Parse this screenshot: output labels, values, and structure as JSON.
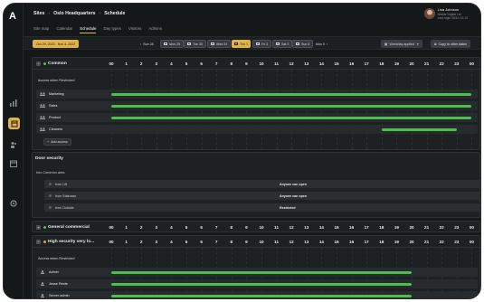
{
  "app": {
    "logo": "A"
  },
  "breadcrumb": {
    "sites": "Sites",
    "location": "Oslo Headquarters",
    "page": "Schedule"
  },
  "nav_tabs": [
    "Site map",
    "Calendar",
    "Schedule",
    "Day types",
    "Visitors",
    "Admins"
  ],
  "active_tab": "Schedule",
  "user": {
    "name": "Lisa Johnson",
    "line2": "Nektar Digital Ltd",
    "line3": "Last login 06/10 12:14"
  },
  "toolbar": {
    "date_range": "Oct 29, 2022 - Nov 4, 2022",
    "days": [
      "Sun 28",
      "Mon 29",
      "Tue 30",
      "Wed 31",
      "Thu 1",
      "Fri 2",
      "Sat 3",
      "Sun 4",
      "Mon 5"
    ],
    "selected_day": "Thu 1",
    "weekday_label": "Weekday applied",
    "copy_label": "Copy to other dates"
  },
  "hours": [
    "00",
    "1",
    "2",
    "3",
    "4",
    "5",
    "6",
    "7",
    "8",
    "9",
    "10",
    "11",
    "12",
    "13",
    "14",
    "15",
    "16",
    "17",
    "18",
    "19",
    "20",
    "21",
    "22",
    "23",
    "00"
  ],
  "colors": {
    "accent": "#e0b24a",
    "bar": "#4cbf4c",
    "dot_green": "#4cbf4c",
    "dot_orange": "#e0a53a"
  },
  "groups": {
    "common": {
      "name": "Common",
      "sublabel": "Access when Restricted",
      "rows": [
        {
          "label": "Marketing",
          "start": 0,
          "end": 24
        },
        {
          "label": "Sales",
          "start": 0,
          "end": 24
        },
        {
          "label": "Product",
          "start": 0,
          "end": 24
        },
        {
          "label": "Cleaners",
          "start": 18,
          "end": 23
        }
      ],
      "add_label": "Add access"
    },
    "door": {
      "title": "Door security",
      "into_label": "Into Common area",
      "rows": [
        {
          "label": "from Lift",
          "value": "Anyone can open"
        },
        {
          "label": "from Staircase",
          "value": "Anyone can open"
        },
        {
          "label": "from Outside",
          "value": "Restricted"
        }
      ]
    },
    "general": {
      "name": "General commercial"
    },
    "high": {
      "name": "High security very lo...",
      "sublabel": "Access when Restricted",
      "rows": [
        {
          "label": "Admin",
          "start": 0,
          "end": 20
        },
        {
          "label": "Jesse Reste",
          "start": 0,
          "end": 20
        },
        {
          "label": "Server admin",
          "start": 0,
          "end": 20
        }
      ]
    }
  }
}
